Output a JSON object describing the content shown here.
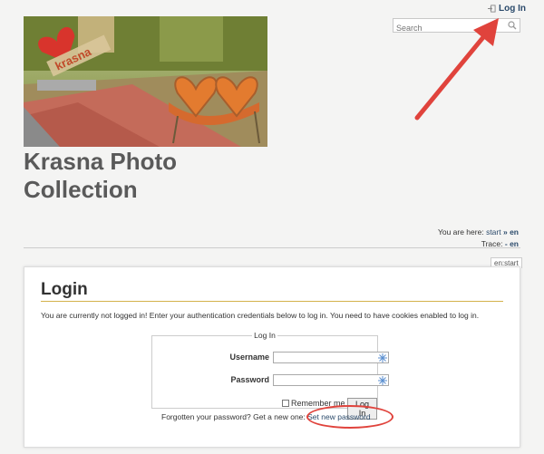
{
  "topbar": {
    "login_label": "Log In",
    "search_placeholder": "Search"
  },
  "header": {
    "title_line1": "Krasna Photo",
    "title_line2": "Collection"
  },
  "breadcrumbs": {
    "here_prefix": "You are here:",
    "here_start": "start",
    "here_sep": "»",
    "here_current": "en",
    "trace_prefix": "Trace:",
    "trace_sep": "-",
    "trace_current": "en"
  },
  "page_id": "en:start",
  "login": {
    "heading": "Login",
    "intro": "You are currently not logged in! Enter your authentication credentials below to log in. You need to have cookies enabled to log in.",
    "legend": "Log In",
    "username_label": "Username",
    "password_label": "Password",
    "remember_label": "Remember me",
    "button_label": "Log In",
    "forgot_text": "Forgotten your password? Get a new one:",
    "forgot_link": "Set new password"
  },
  "hero_image": {
    "heart_sign_text": "krasna"
  },
  "colors": {
    "accent_rule": "#d4b24c",
    "link": "#2b4a6b",
    "annotation": "#e0433c"
  }
}
